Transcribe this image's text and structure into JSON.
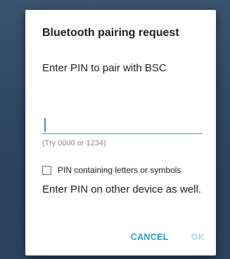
{
  "dialog": {
    "title": "Bluetooth pairing request",
    "message": "Enter PIN to pair with BSC",
    "pin_value": "",
    "hint": "(Try 0000 or 1234)",
    "checkbox_label": "PIN containing letters or symbols",
    "checkbox_checked": false,
    "instruction": "Enter PIN on other device as well.",
    "cancel_label": "CANCEL",
    "ok_label": "OK",
    "ok_enabled": false
  },
  "colors": {
    "accent": "#27a0c9",
    "accent_disabled": "#a6d9e9",
    "backdrop": "#2f4660",
    "text_primary": "#212121",
    "text_hint": "#8a8a8a"
  }
}
